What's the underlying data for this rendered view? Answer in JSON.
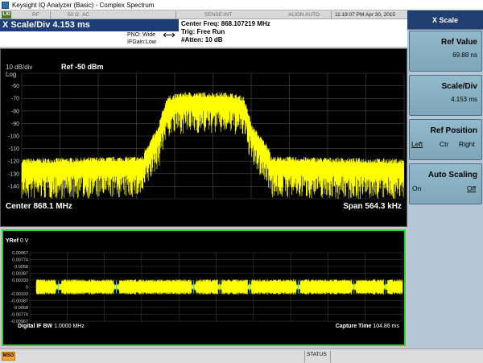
{
  "window": {
    "title": "Keysight IQ Analyzer (Basic) - Complex Spectrum"
  },
  "status_row": {
    "lxi": "LXI",
    "rf": "RF",
    "impedance": "50 Ω",
    "coupling": "AC",
    "sense": "SENSE:INT",
    "align": "ALIGN AUTO",
    "datetime": "11:19:07 PM Apr 30, 2015"
  },
  "header": {
    "xscale_title": "X Scale/Div 4.153 ms",
    "pno": "PNO: Wide",
    "ifgain": "IFGain:Low",
    "center_freq": "Center Freq: 868.107219 MHz",
    "trig": "Trig: Free Run",
    "atten": "#Atten: 10 dB"
  },
  "spectrum": {
    "scale_label": "10 dB/div",
    "log_label": "Log",
    "ref_label": "Ref  -50 dBm",
    "y_ticks": [
      "-60",
      "-70",
      "-80",
      "-90",
      "-100",
      "-110",
      "-120",
      "-130",
      "-140"
    ],
    "center_label": "Center  868.1 MHz",
    "span_label": "Span 564.3 kHz",
    "trace_color": "#ffff00"
  },
  "iq": {
    "yref_label": "YRef",
    "yref_value": "0 V",
    "y_ticks": [
      "0.00967",
      "0.00774",
      "0.0058",
      "0.00387",
      "0.00193",
      "0",
      "-0.00193",
      "-0.00387",
      "-0.0058",
      "-0.00774",
      "-0.00967"
    ],
    "bw_label": "Digital IF BW",
    "bw_value": "1.0000 MHz",
    "capture_label": "Capture Time",
    "capture_value": "104.86 ms",
    "trace_color": "#ffff00",
    "border_color": "#2bd13a"
  },
  "panel": {
    "title": "X Scale",
    "ref_value": {
      "label": "Ref Value",
      "value": "69.88 ns"
    },
    "scale_div": {
      "label": "Scale/Div",
      "value": "4.153 ms"
    },
    "ref_position": {
      "label": "Ref Position",
      "options": [
        "Left",
        "Ctr",
        "Right"
      ],
      "selected": "Left"
    },
    "auto_scaling": {
      "label": "Auto Scaling",
      "options": [
        "On",
        "Off"
      ],
      "selected": "Off"
    }
  },
  "bottom_bar": {
    "msg": "MSG",
    "status": "STATUS"
  }
}
